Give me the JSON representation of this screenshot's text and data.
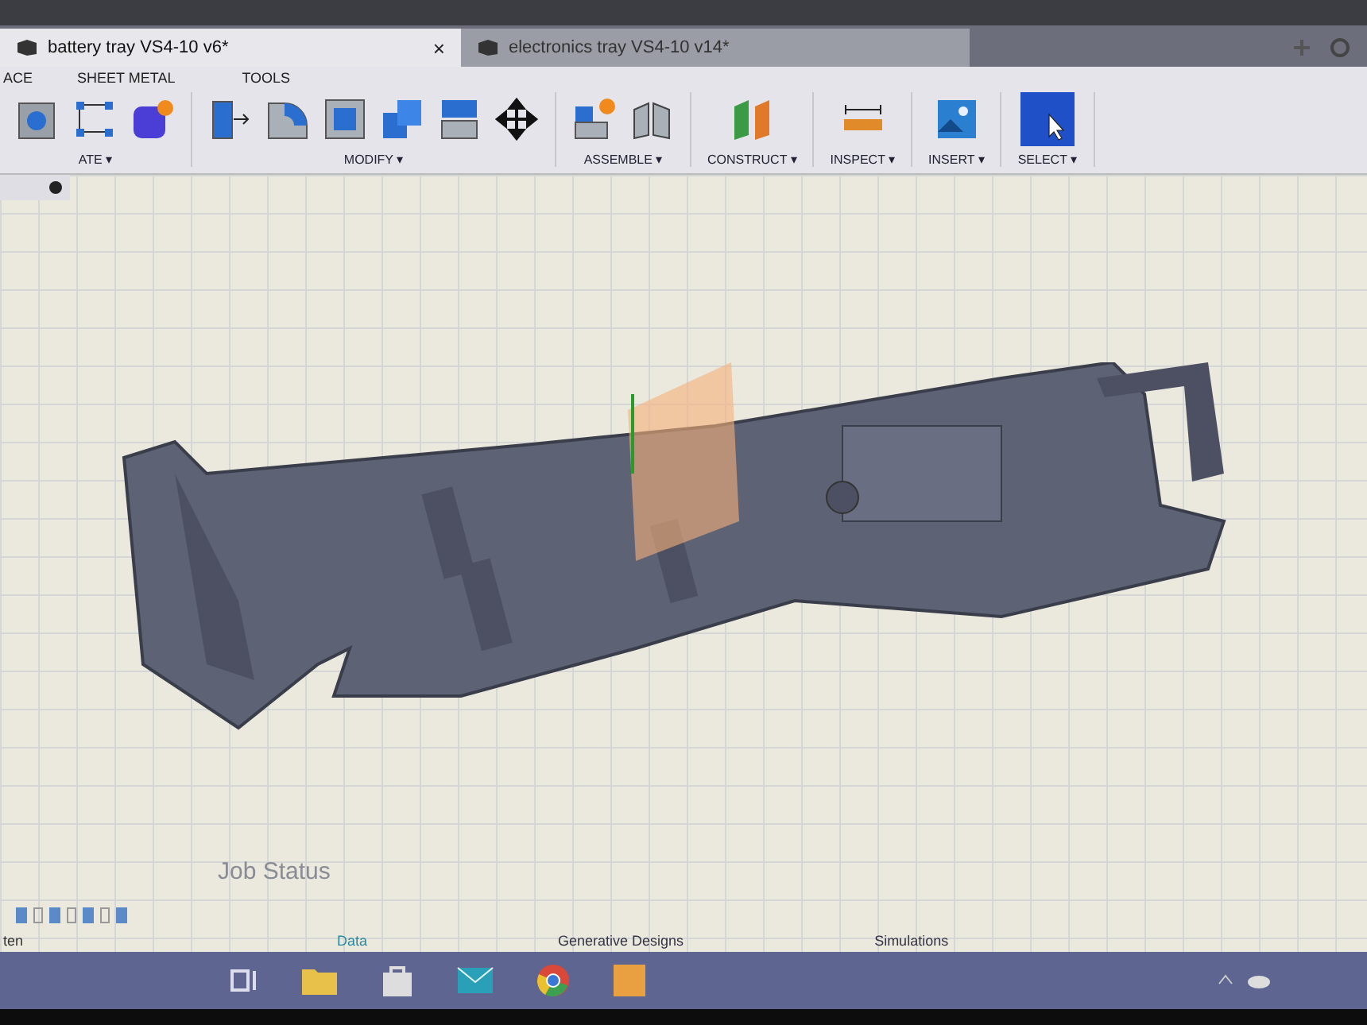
{
  "tabs": [
    {
      "label": "battery tray VS4-10 v6*",
      "selected": true,
      "close": "×"
    },
    {
      "label": "electronics tray VS4-10 v14*",
      "selected": false
    }
  ],
  "workspace_tabs": [
    "ACE",
    "SHEET METAL",
    "TOOLS"
  ],
  "tool_groups": [
    {
      "label": "ATE",
      "caret": "▾"
    },
    {
      "label": "MODIFY",
      "caret": "▾"
    },
    {
      "label": "ASSEMBLE",
      "caret": "▾"
    },
    {
      "label": "CONSTRUCT",
      "caret": "▾"
    },
    {
      "label": "INSPECT",
      "caret": "▾"
    },
    {
      "label": "INSERT",
      "caret": "▾"
    },
    {
      "label": "SELECT",
      "caret": "▾"
    }
  ],
  "job_status": {
    "title": "Job Status"
  },
  "bottom_tabs": [
    "Data",
    "Generative Designs",
    "Simulations"
  ],
  "status_text": "ten"
}
